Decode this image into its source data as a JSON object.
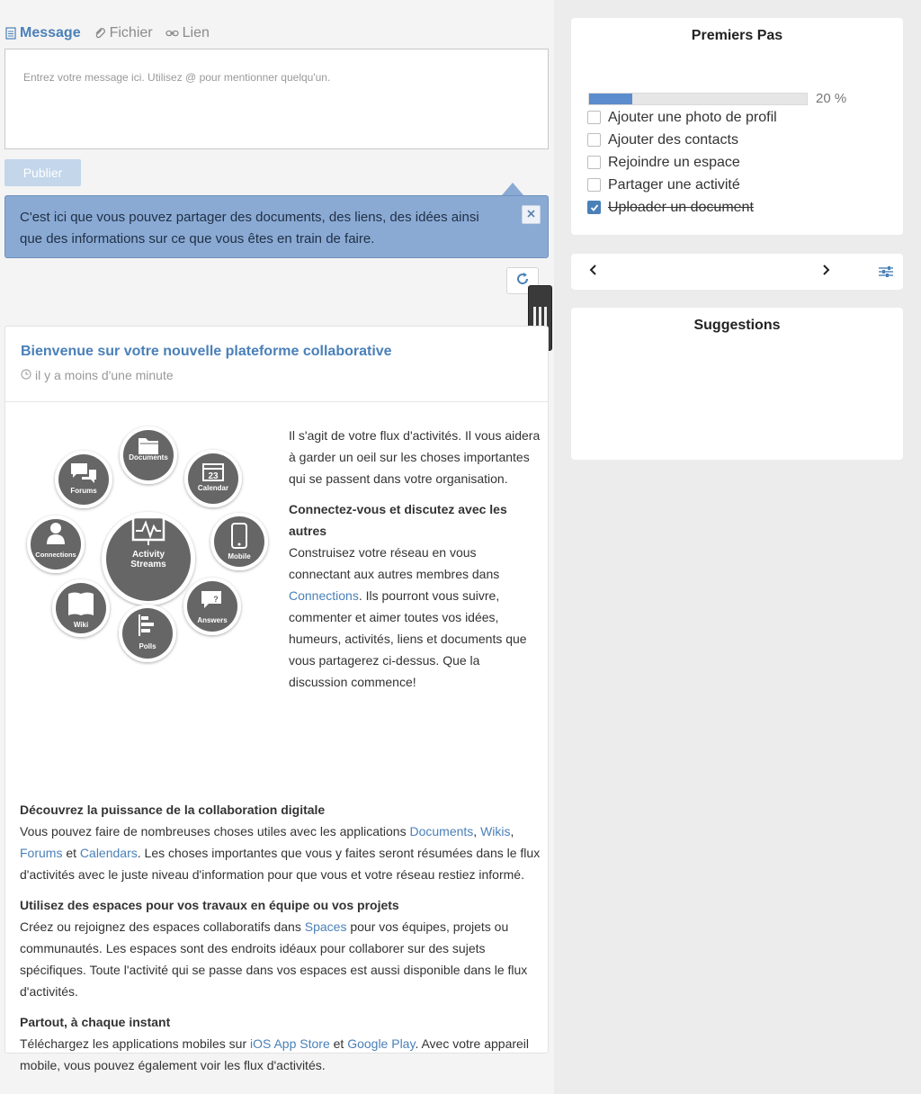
{
  "composer": {
    "tabs": [
      {
        "label": "Message",
        "icon": "message-icon",
        "active": true
      },
      {
        "label": "Fichier",
        "icon": "paperclip-icon",
        "active": false
      },
      {
        "label": "Lien",
        "icon": "link-icon",
        "active": false
      }
    ],
    "placeholder": "Entrez votre message ici. Utilisez @ pour mentionner quelqu'un.",
    "publish_label": "Publier"
  },
  "tip": {
    "text": "C'est ici que vous pouvez partager des documents, des liens, des idées ainsi que des informations sur ce que vous êtes en train de faire."
  },
  "activity": {
    "title": "Bienvenue sur votre nouvelle plateforme collaborative",
    "time": "il y a moins d'une minute",
    "hub": {
      "center": [
        "Activity",
        "Streams"
      ],
      "apps": [
        "Documents",
        "Calendar",
        "Mobile",
        "Answers",
        "Polls",
        "Wiki",
        "Connections",
        "Forums"
      ],
      "calendar_day": "23"
    },
    "intro": "Il s'agit de votre flux d'activités. Il vous aidera à garder un oeil sur les choses importantes qui se passent dans votre organisation.",
    "connect_title": "Connectez-vous et discutez avec les autres",
    "connect_pre": "Construisez votre réseau en vous connectant aux autres membres dans ",
    "connect_link": "Connections",
    "connect_post": ". Ils pourront vous suivre, commenter et aimer toutes vos idées, humeurs, activités, liens et documents que vous partagerez ci-dessus. Que la discussion commence!",
    "collab_title": "Découvrez la puissance de la collaboration digitale",
    "collab_pre": "Vous pouvez faire de nombreuses choses utiles avec les applications ",
    "collab_link1": "Documents",
    "collab_sep1": ", ",
    "collab_link2": "Wikis",
    "collab_sep2": ", ",
    "collab_link3": "Forums",
    "collab_sep3": " et ",
    "collab_link4": "Calendars",
    "collab_post": ". Les choses importantes que vous y faites seront résumées dans le flux d'activités avec le juste niveau d'information pour que vous et votre réseau restiez informé.",
    "spaces_title": "Utilisez des espaces pour vos travaux en équipe ou vos projets",
    "spaces_pre": "Créez ou rejoignez des espaces collaboratifs dans ",
    "spaces_link": "Spaces",
    "spaces_post": " pour vos équipes, projets ou communautés. Les espaces sont des endroits idéaux pour collaborer sur des sujets spécifiques. Toute l'activité qui se passe dans vos espaces est aussi disponible dans le flux d'activités.",
    "mobile_title": "Partout, à chaque instant",
    "mobile_pre": "Téléchargez les applications mobiles sur ",
    "mobile_link1": "iOS App Store",
    "mobile_sep": " et ",
    "mobile_link2": "Google Play",
    "mobile_post": ". Avec votre appareil mobile, vous pouvez également voir les flux d'activités."
  },
  "getting_started": {
    "title": "Premiers Pas",
    "progress": 0.2,
    "progress_label": "20 %",
    "items": [
      {
        "label": "Ajouter une photo de profil",
        "done": false
      },
      {
        "label": "Ajouter des contacts",
        "done": false
      },
      {
        "label": "Rejoindre un espace",
        "done": false
      },
      {
        "label": "Partager une activité",
        "done": false
      },
      {
        "label": "Uploader un document",
        "done": true
      }
    ]
  },
  "suggestions": {
    "title": "Suggestions"
  },
  "colors": {
    "accent": "#4a80b8",
    "tip_bg": "#8aaad4",
    "hub_grey": "#666666"
  }
}
